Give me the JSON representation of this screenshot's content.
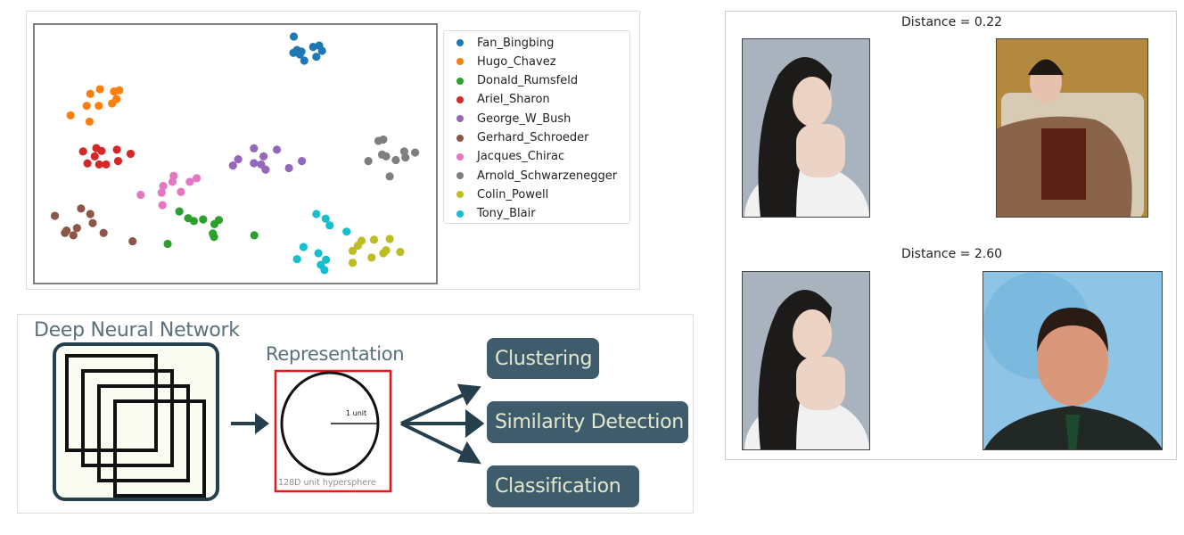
{
  "chart_data": {
    "type": "scatter",
    "title": "",
    "xlabel": "",
    "ylabel": "",
    "xlim": [
      0,
      100
    ],
    "ylim": [
      0,
      100
    ],
    "grid": false,
    "ticks": false,
    "legend_placement": "outside-right",
    "series": [
      {
        "name": "Fan_Bingbing",
        "color": "#1f77b4",
        "points": [
          [
            64.5,
            95.2
          ],
          [
            64.4,
            88.9
          ],
          [
            65.3,
            90.0
          ],
          [
            66.4,
            89.4
          ],
          [
            67.1,
            85.9
          ],
          [
            69.3,
            91.2
          ],
          [
            70.8,
            91.7
          ],
          [
            71.5,
            89.7
          ],
          [
            70.1,
            87.4
          ],
          [
            66.0,
            88.3
          ]
        ]
      },
      {
        "name": "Hugo_Chavez",
        "color": "#ff7f0e",
        "points": [
          [
            9.1,
            64.8
          ],
          [
            13.8,
            62.4
          ],
          [
            13.1,
            68.5
          ],
          [
            16.1,
            68.5
          ],
          [
            14.0,
            73.1
          ],
          [
            16.4,
            74.9
          ],
          [
            19.9,
            74.0
          ],
          [
            21.2,
            74.5
          ],
          [
            20.5,
            71.1
          ],
          [
            19.4,
            69.4
          ]
        ]
      },
      {
        "name": "Donald_Rumsfeld",
        "color": "#2ca02c",
        "points": [
          [
            36.1,
            27.8
          ],
          [
            38.3,
            25.2
          ],
          [
            39.7,
            24.1
          ],
          [
            42.0,
            24.7
          ],
          [
            44.8,
            22.9
          ],
          [
            45.9,
            24.5
          ],
          [
            44.4,
            19.3
          ],
          [
            44.7,
            18.0
          ],
          [
            33.2,
            15.3
          ],
          [
            54.7,
            18.6
          ]
        ]
      },
      {
        "name": "Ariel_Sharon",
        "color": "#d62728",
        "points": [
          [
            12.2,
            50.9
          ],
          [
            15.5,
            52.2
          ],
          [
            16.8,
            51.1
          ],
          [
            15.1,
            49.0
          ],
          [
            13.3,
            46.3
          ],
          [
            16.2,
            45.9
          ],
          [
            17.9,
            45.9
          ],
          [
            20.6,
            51.6
          ],
          [
            20.9,
            47.2
          ],
          [
            24.0,
            50.0
          ]
        ]
      },
      {
        "name": "George_W_Bush",
        "color": "#9467bd",
        "points": [
          [
            49.4,
            45.5
          ],
          [
            50.7,
            47.9
          ],
          [
            54.6,
            52.1
          ],
          [
            54.6,
            46.4
          ],
          [
            57.0,
            49.0
          ],
          [
            56.4,
            45.9
          ],
          [
            57.5,
            43.9
          ],
          [
            60.3,
            51.6
          ],
          [
            63.3,
            44.5
          ],
          [
            66.5,
            47.2
          ]
        ]
      },
      {
        "name": "Gerhard_Schroeder",
        "color": "#8c564b",
        "points": [
          [
            5.2,
            26.1
          ],
          [
            11.7,
            28.9
          ],
          [
            14.0,
            26.8
          ],
          [
            14.6,
            23.3
          ],
          [
            10.7,
            21.4
          ],
          [
            8.1,
            20.4
          ],
          [
            7.7,
            19.5
          ],
          [
            9.8,
            18.6
          ],
          [
            17.3,
            19.5
          ],
          [
            24.5,
            16.3
          ]
        ]
      },
      {
        "name": "Jacques_Chirac",
        "color": "#e377c2",
        "points": [
          [
            26.5,
            34.2
          ],
          [
            31.7,
            35.0
          ],
          [
            32.1,
            37.6
          ],
          [
            34.4,
            39.2
          ],
          [
            34.7,
            41.5
          ],
          [
            36.5,
            35.3
          ],
          [
            38.7,
            39.2
          ],
          [
            40.4,
            40.6
          ],
          [
            31.9,
            30.2
          ]
        ]
      },
      {
        "name": "Arnold_Schwarzenegger",
        "color": "#7f7f7f",
        "points": [
          [
            85.5,
            55.0
          ],
          [
            86.7,
            55.5
          ],
          [
            83.0,
            47.2
          ],
          [
            86.4,
            49.7
          ],
          [
            87.4,
            49.0
          ],
          [
            89.8,
            47.6
          ],
          [
            91.9,
            50.9
          ],
          [
            92.2,
            48.6
          ],
          [
            94.6,
            50.5
          ],
          [
            88.3,
            41.3
          ]
        ]
      },
      {
        "name": "Colin_Powell",
        "color": "#bcbd22",
        "points": [
          [
            81.3,
            16.5
          ],
          [
            80.4,
            14.6
          ],
          [
            79.1,
            12.6
          ],
          [
            84.4,
            16.9
          ],
          [
            88.3,
            17.2
          ],
          [
            87.4,
            12.8
          ],
          [
            86.7,
            11.7
          ],
          [
            90.9,
            12.2
          ],
          [
            83.8,
            10.0
          ],
          [
            79.1,
            8.0
          ]
        ]
      },
      {
        "name": "Tony_Blair",
        "color": "#17becf",
        "points": [
          [
            70.1,
            26.8
          ],
          [
            72.4,
            25.0
          ],
          [
            73.4,
            22.4
          ],
          [
            77.6,
            20.0
          ],
          [
            66.9,
            14.1
          ],
          [
            65.3,
            9.4
          ],
          [
            70.6,
            11.7
          ],
          [
            72.5,
            9.2
          ],
          [
            71.2,
            7.2
          ],
          [
            72.1,
            5.2
          ]
        ]
      }
    ]
  },
  "diagram": {
    "network_title": "Deep Neural Network",
    "representation_title": "Representation",
    "unit_label": "1 unit",
    "hypersphere_label": "128D unit hypersphere",
    "actions": [
      "Clustering",
      "Similarity Detection",
      "Classification"
    ],
    "colors": {
      "action_fill": "#3f5c6c",
      "action_text": "#e4e8cf",
      "highlight_box": "#e8161b",
      "title_text": "#5b707b"
    }
  },
  "faces": {
    "pairs": [
      {
        "label": "Distance = 0.22",
        "left": "Fan_Bingbing",
        "right": "Fan_Bingbing"
      },
      {
        "label": "Distance = 2.60",
        "left": "Fan_Bingbing",
        "right": "Gerhard_Schroeder"
      }
    ]
  }
}
